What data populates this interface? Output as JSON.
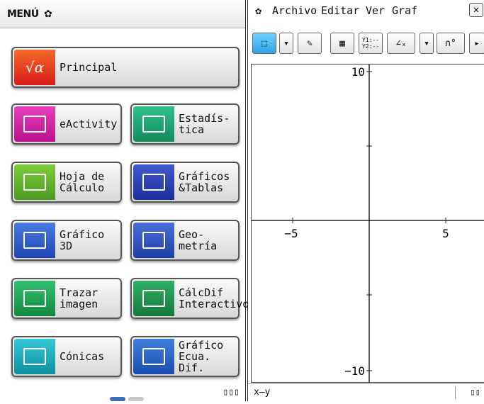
{
  "menu_panel": {
    "title": "MENÚ",
    "apps": [
      {
        "label": "Principal",
        "icon": "sqrt-alpha-icon",
        "color": "#e8331c"
      },
      {
        "label": "eActivity",
        "icon": "eactivity-icon",
        "color": "#c8169a"
      },
      {
        "label": "Estadís-\ntica",
        "icon": "bar-chart-icon",
        "color": "#179f6b"
      },
      {
        "label": "Hoja de\nCálculo",
        "icon": "spreadsheet-icon",
        "color": "#5aad2a"
      },
      {
        "label": "Gráficos\n&Tablas",
        "icon": "graph-table-icon",
        "color": "#263fb0"
      },
      {
        "label": "Gráfico 3D",
        "icon": "3d-axes-icon",
        "color": "#2555c8"
      },
      {
        "label": "Geo-\nmetría",
        "icon": "geometry-icon",
        "color": "#2a50c0"
      },
      {
        "label": "Trazar\nimagen",
        "icon": "picture-plot-icon",
        "color": "#16a052"
      },
      {
        "label": "CálcDif\nInteractivo",
        "icon": "diffcalc-icon",
        "color": "#1e8f4a"
      },
      {
        "label": "Cónicas",
        "icon": "conics-icon",
        "color": "#12a8b8"
      },
      {
        "label": "Gráfico\nEcua. Dif.",
        "icon": "diff-eq-graph-icon",
        "color": "#1f5fc0"
      }
    ],
    "page_indicator": {
      "pages": 2,
      "current": 1
    }
  },
  "graph_panel": {
    "menus": [
      "Archivo",
      "Editar",
      "Ver",
      "Graf"
    ],
    "toolbar": {
      "table_label": "Y1:--\nY2:--"
    },
    "axes": {
      "x_min": -10,
      "x_max": 10,
      "y_min": -10,
      "y_max": 10
    },
    "labels": {
      "y_top": "10",
      "y_bottom": "−10",
      "x_left": "−5",
      "x_right": "5"
    },
    "status": "x–y"
  }
}
